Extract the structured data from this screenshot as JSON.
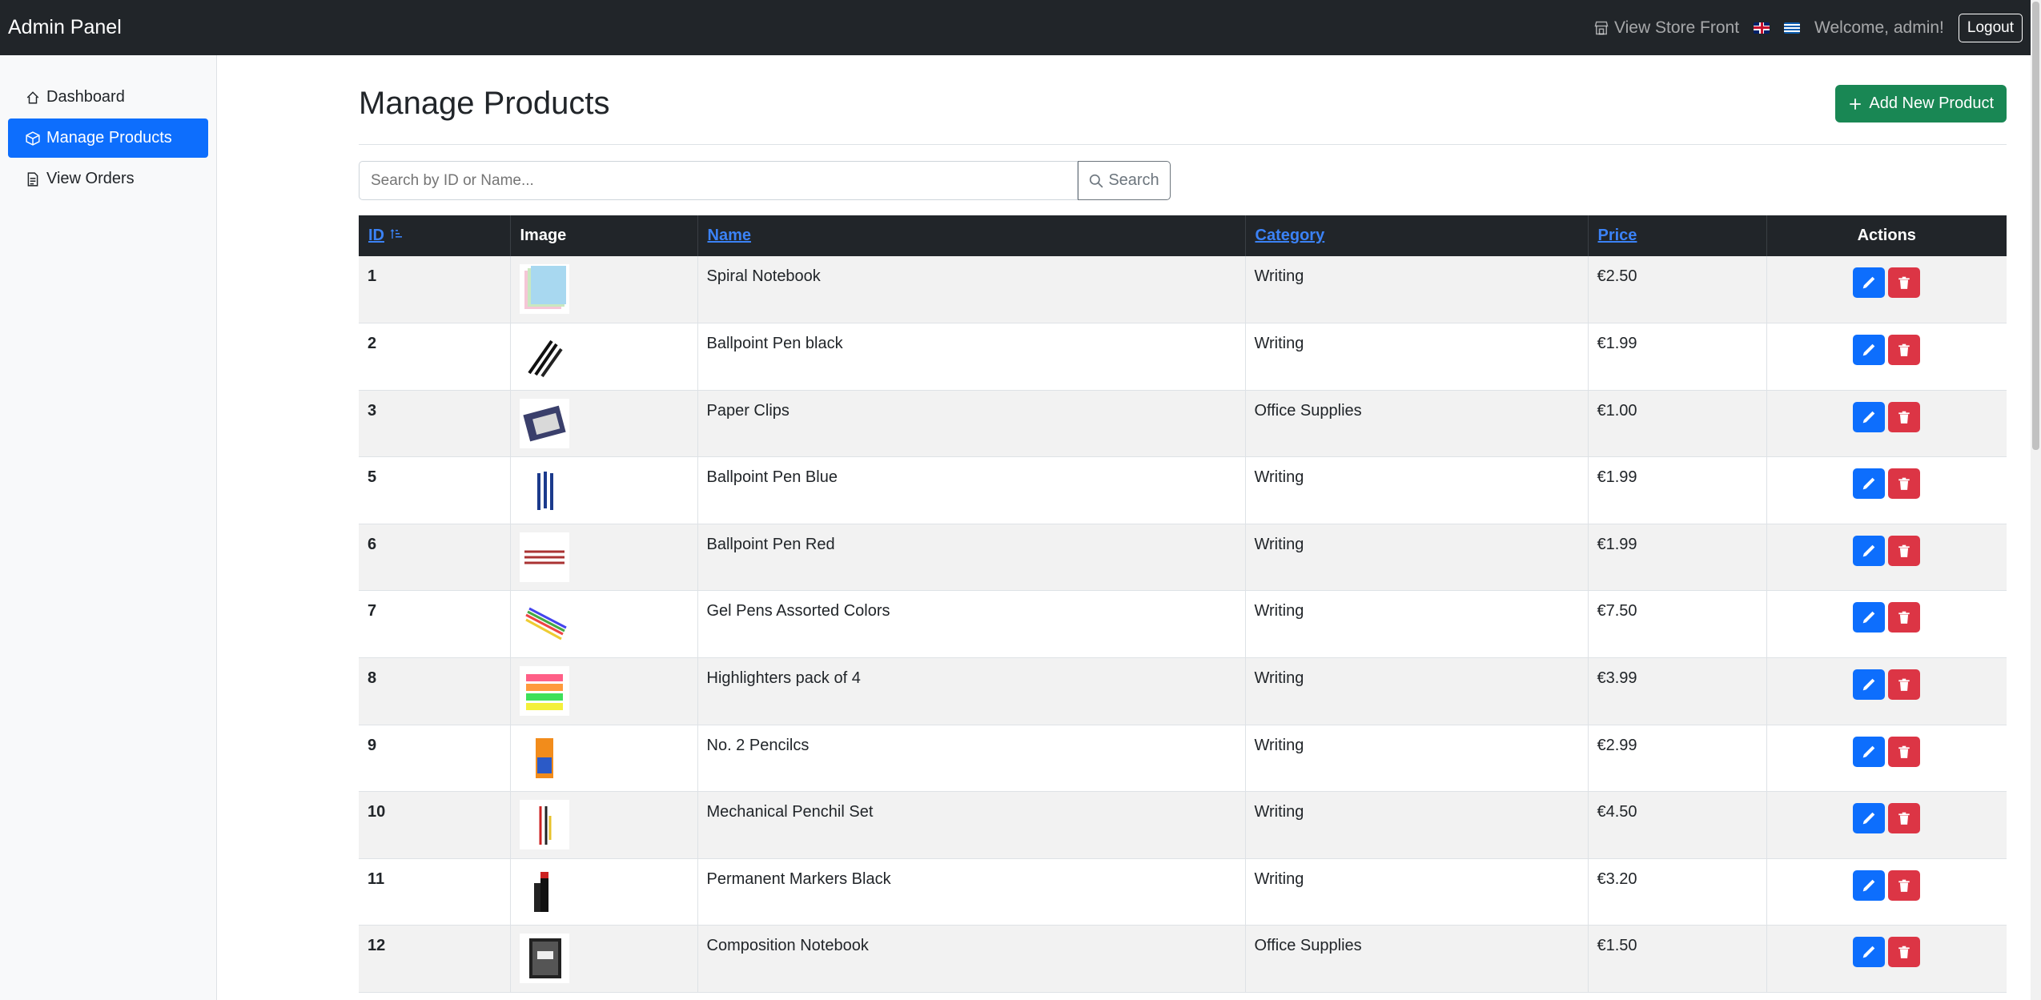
{
  "navbar": {
    "brand": "Admin Panel",
    "storefront_label": "View Store Front",
    "welcome": "Welcome, admin!",
    "logout_label": "Logout"
  },
  "sidebar": {
    "items": [
      {
        "label": "Dashboard",
        "icon": "house-icon",
        "active": false
      },
      {
        "label": "Manage Products",
        "icon": "box-icon",
        "active": true
      },
      {
        "label": "View Orders",
        "icon": "document-icon",
        "active": false
      }
    ]
  },
  "main": {
    "title": "Manage Products",
    "add_button": "Add New Product",
    "search_placeholder": "Search by ID or Name...",
    "search_button": "Search"
  },
  "table": {
    "headers": {
      "id": "ID",
      "image": "Image",
      "name": "Name",
      "category": "Category",
      "price": "Price",
      "actions": "Actions"
    },
    "rows": [
      {
        "id": "1",
        "name": "Spiral Notebook",
        "category": "Writing",
        "price": "€2.50"
      },
      {
        "id": "2",
        "name": "Ballpoint Pen black",
        "category": "Writing",
        "price": "€1.99"
      },
      {
        "id": "3",
        "name": "Paper Clips",
        "category": "Office Supplies",
        "price": "€1.00"
      },
      {
        "id": "5",
        "name": "Ballpoint Pen Blue",
        "category": "Writing",
        "price": "€1.99"
      },
      {
        "id": "6",
        "name": "Ballpoint Pen Red",
        "category": "Writing",
        "price": "€1.99"
      },
      {
        "id": "7",
        "name": "Gel Pens Assorted Colors",
        "category": "Writing",
        "price": "€7.50"
      },
      {
        "id": "8",
        "name": "Highlighters pack of 4",
        "category": "Writing",
        "price": "€3.99"
      },
      {
        "id": "9",
        "name": "No. 2 Pencilcs",
        "category": "Writing",
        "price": "€2.99"
      },
      {
        "id": "10",
        "name": "Mechanical Penchil Set",
        "category": "Writing",
        "price": "€4.50"
      },
      {
        "id": "11",
        "name": "Permanent Markers Black",
        "category": "Writing",
        "price": "€3.20"
      },
      {
        "id": "12",
        "name": "Composition Notebook",
        "category": "Office Supplies",
        "price": "€1.50"
      }
    ]
  },
  "colors": {
    "navbar_bg": "#212529",
    "primary": "#0d6efd",
    "success": "#198754",
    "danger": "#dc3545"
  }
}
